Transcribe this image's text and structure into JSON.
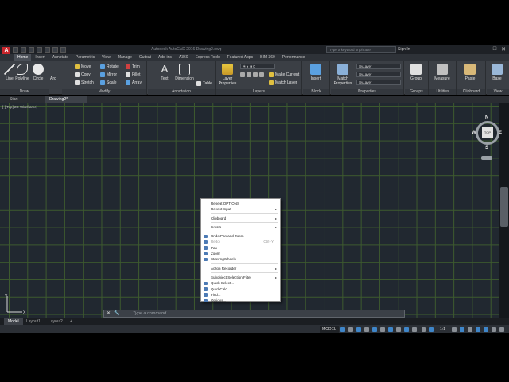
{
  "app": {
    "logo": "A",
    "title": "Autodesk AutoCAD 2016   Drawing2.dwg",
    "search_placeholder": "Type a keyword or phrase",
    "sign_in": "Sign In"
  },
  "ribbon_tabs": [
    "Home",
    "Insert",
    "Annotate",
    "Parametric",
    "View",
    "Manage",
    "Output",
    "Add-ins",
    "A360",
    "Express Tools",
    "Featured Apps",
    "BIM 360",
    "Performance"
  ],
  "panels": {
    "draw": {
      "title": "Draw",
      "line": "Line",
      "polyline": "Polyline",
      "circle": "Circle",
      "arc": "Arc"
    },
    "modify": {
      "title": "Modify",
      "move": "Move",
      "rotate": "Rotate",
      "trim": "Trim",
      "copy": "Copy",
      "mirror": "Mirror",
      "fillet": "Fillet",
      "stretch": "Stretch",
      "scale": "Scale",
      "array": "Array"
    },
    "annotation": {
      "title": "Annotation",
      "text": "Text",
      "dimension": "Dimension",
      "table": "Table"
    },
    "layers": {
      "title": "Layers",
      "layer_properties": "Layer Properties",
      "make_current": "Make Current",
      "match_layer": "Match Layer"
    },
    "block": {
      "title": "Block",
      "insert": "Insert"
    },
    "properties": {
      "title": "Properties",
      "match_properties": "Match Properties",
      "bylayer1": "ByLayer",
      "bylayer2": "ByLayer",
      "bylayer3": "ByLayer"
    },
    "groups": {
      "title": "Groups",
      "group": "Group"
    },
    "utilities": {
      "title": "Utilities",
      "measure": "Measure"
    },
    "clipboard": {
      "title": "Clipboard",
      "paste": "Paste"
    },
    "view": {
      "title": "View",
      "base": "Base"
    }
  },
  "file_tabs": {
    "start": "Start",
    "drawing": "Drawing2*",
    "add": "+"
  },
  "viewport": {
    "label": "[-][Top][2D Wireframe]"
  },
  "viewcube": {
    "n": "N",
    "s": "S",
    "e": "E",
    "w": "W",
    "top": "TOP"
  },
  "context_menu": {
    "items": [
      {
        "label": "Repeat OPTIONS",
        "arrow": "",
        "shortcut": "",
        "disabled": false
      },
      {
        "label": "Recent Input",
        "arrow": "▸",
        "shortcut": "",
        "disabled": false
      },
      {
        "sep": true
      },
      {
        "label": "Clipboard",
        "arrow": "▸",
        "shortcut": "",
        "disabled": false
      },
      {
        "sep": true
      },
      {
        "label": "Isolate",
        "arrow": "▸",
        "shortcut": "",
        "disabled": false
      },
      {
        "sep": true
      },
      {
        "label": "Undo Pan and Zoom",
        "arrow": "",
        "shortcut": "",
        "disabled": false,
        "icon": true
      },
      {
        "label": "Redo",
        "arrow": "",
        "shortcut": "Ctrl+Y",
        "disabled": true,
        "icon": true
      },
      {
        "label": "Pan",
        "arrow": "",
        "shortcut": "",
        "disabled": false,
        "icon": true
      },
      {
        "label": "Zoom",
        "arrow": "",
        "shortcut": "",
        "disabled": false,
        "icon": true
      },
      {
        "label": "SteeringWheels",
        "arrow": "",
        "shortcut": "",
        "disabled": false,
        "icon": true
      },
      {
        "sep": true
      },
      {
        "label": "Action Recorder",
        "arrow": "▸",
        "shortcut": "",
        "disabled": false
      },
      {
        "sep": true
      },
      {
        "label": "Subobject Selection Filter",
        "arrow": "▸",
        "shortcut": "",
        "disabled": false
      },
      {
        "label": "Quick Select...",
        "arrow": "",
        "shortcut": "",
        "disabled": false,
        "icon": true
      },
      {
        "label": "QuickCalc",
        "arrow": "",
        "shortcut": "",
        "disabled": false,
        "icon": true
      },
      {
        "label": "Find...",
        "arrow": "",
        "shortcut": "",
        "disabled": false,
        "icon": true
      },
      {
        "label": "Options...",
        "arrow": "",
        "shortcut": "",
        "disabled": false,
        "icon": true
      }
    ]
  },
  "command_line": {
    "close": "✕",
    "customize": "🔧",
    "placeholder": "Type a command"
  },
  "layout_tabs": {
    "model": "Model",
    "layout1": "Layout1",
    "layout2": "Layout2",
    "add": "+"
  },
  "status": {
    "model": "MODEL",
    "scale": "1:1"
  }
}
